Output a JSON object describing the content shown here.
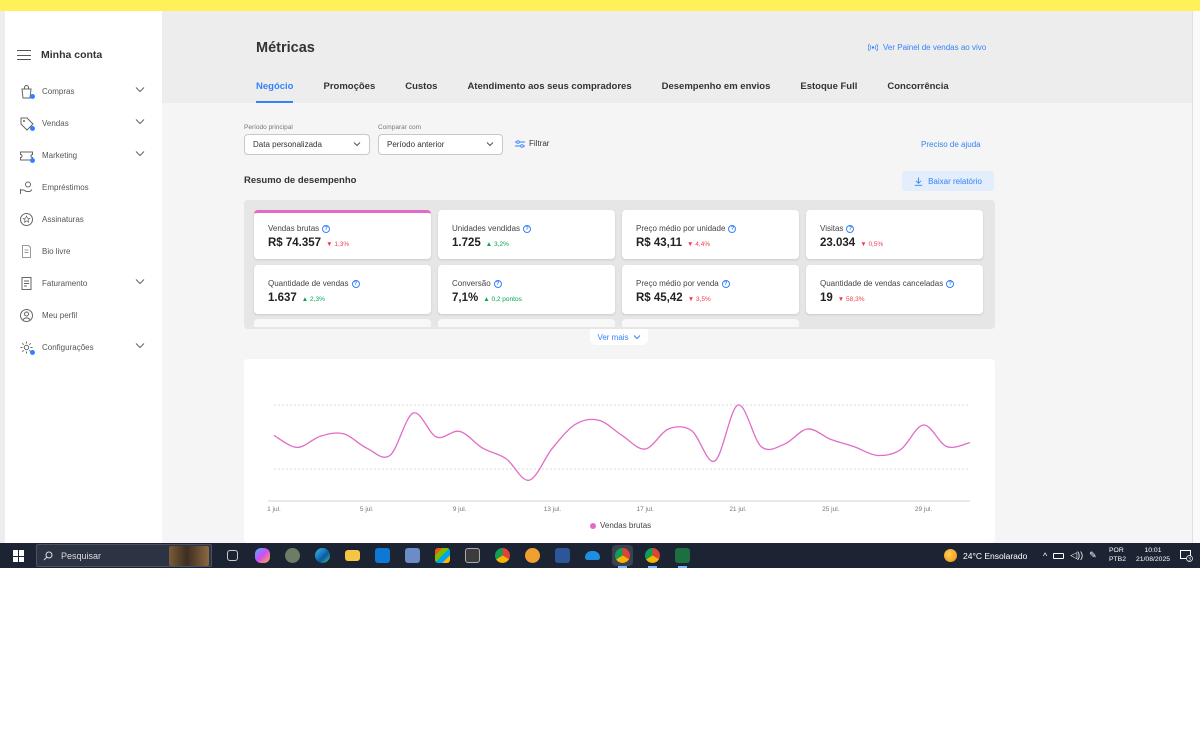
{
  "sidebar": {
    "title": "Minha conta",
    "items": [
      {
        "label": "Compras",
        "icon": "bag-icon",
        "chevron": true,
        "dot": true
      },
      {
        "label": "Vendas",
        "icon": "tag-icon",
        "chevron": true,
        "dot": true
      },
      {
        "label": "Marketing",
        "icon": "ticket-icon",
        "chevron": true,
        "dot": true
      },
      {
        "label": "Empréstimos",
        "icon": "hand-coin-icon",
        "chevron": false,
        "dot": false
      },
      {
        "label": "Assinaturas",
        "icon": "star-badge-icon",
        "chevron": false,
        "dot": false
      },
      {
        "label": "Bio livre",
        "icon": "document-icon",
        "chevron": false,
        "dot": false
      },
      {
        "label": "Faturamento",
        "icon": "invoice-icon",
        "chevron": true,
        "dot": false
      },
      {
        "label": "Meu perfil",
        "icon": "user-icon",
        "chevron": false,
        "dot": false
      },
      {
        "label": "Configurações",
        "icon": "gear-icon",
        "chevron": true,
        "dot": true
      }
    ]
  },
  "header": {
    "title": "Métricas",
    "live_link": "Ver Painel de vendas ao vivo",
    "tabs": [
      "Negócio",
      "Promoções",
      "Custos",
      "Atendimento aos seus compradores",
      "Desempenho em envios",
      "Estoque Full",
      "Concorrência"
    ],
    "active_tab": "Negócio"
  },
  "filters": {
    "period_label": "Período principal",
    "period_value": "Data personalizada",
    "compare_label": "Comparar com",
    "compare_value": "Período anterior",
    "filter_label": "Filtrar",
    "help_link": "Preciso de ajuda"
  },
  "summary": {
    "title": "Resumo de desempenho",
    "download_label": "Baixar relatório",
    "see_more": "Ver mais",
    "cards": [
      {
        "label": "Vendas brutas",
        "value": "R$ 74.357",
        "delta": "1,3%",
        "dir": "down",
        "selected": true
      },
      {
        "label": "Unidades vendidas",
        "value": "1.725",
        "delta": "3,2%",
        "dir": "up",
        "selected": false
      },
      {
        "label": "Preço médio por unidade",
        "value": "R$ 43,11",
        "delta": "4,4%",
        "dir": "down",
        "selected": false
      },
      {
        "label": "Visitas",
        "value": "23.034",
        "delta": "0,5%",
        "dir": "down",
        "selected": false
      },
      {
        "label": "Quantidade de vendas",
        "value": "1.637",
        "delta": "2,3%",
        "dir": "up",
        "selected": false
      },
      {
        "label": "Conversão",
        "value": "7,1%",
        "delta": "0,2 pontos",
        "dir": "up",
        "selected": false
      },
      {
        "label": "Preço médio por venda",
        "value": "R$ 45,42",
        "delta": "3,5%",
        "dir": "down",
        "selected": false
      },
      {
        "label": "Quantidade de vendas canceladas",
        "value": "19",
        "delta": "58,3%",
        "dir": "down",
        "selected": false
      }
    ]
  },
  "chart_data": {
    "type": "line",
    "x": [
      1,
      2,
      3,
      4,
      5,
      6,
      7,
      8,
      9,
      10,
      11,
      12,
      13,
      14,
      15,
      16,
      17,
      18,
      19,
      20,
      21,
      22,
      23,
      24,
      25,
      26,
      27,
      28,
      29,
      30,
      31
    ],
    "tick_labels": [
      "1 jul.",
      "5 jul.",
      "9 jul.",
      "13 jul.",
      "17 jul.",
      "21 jul.",
      "25 jul.",
      "29 jul."
    ],
    "tick_days": [
      1,
      5,
      9,
      13,
      17,
      21,
      25,
      29
    ],
    "series": [
      {
        "name": "Vendas brutas",
        "color": "#e16cc6",
        "values": [
          2420,
          2270,
          2410,
          2440,
          2260,
          2170,
          2700,
          2400,
          2470,
          2260,
          2130,
          1860,
          2260,
          2560,
          2610,
          2420,
          2250,
          2500,
          2480,
          2100,
          2800,
          2280,
          2310,
          2500,
          2370,
          2280,
          2170,
          2240,
          2550,
          2280,
          2330
        ]
      }
    ],
    "ylim": [
      1600,
      3000
    ],
    "grid": true,
    "legend": "bottom-center",
    "title": "",
    "xlabel": "",
    "ylabel": ""
  },
  "taskbar": {
    "search_placeholder": "Pesquisar",
    "weather": "24°C  Ensolarado",
    "lang_top": "POR",
    "lang_bottom": "PTB2",
    "time": "10:01",
    "date": "21/08/2025",
    "notification_count": "3"
  }
}
